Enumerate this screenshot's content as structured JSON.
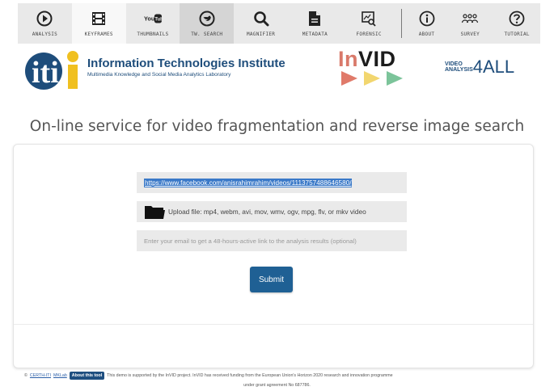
{
  "toolbar": {
    "items": [
      {
        "label": "ANALYSIS",
        "icon": "play-circle-icon"
      },
      {
        "label": "KEYFRAMES",
        "icon": "film-icon"
      },
      {
        "label": "THUMBNAILS",
        "icon": "youtube-icon"
      },
      {
        "label": "TW. SEARCH",
        "icon": "twitter-circle-icon"
      },
      {
        "label": "MAGNIFIER",
        "icon": "magnifier-icon"
      },
      {
        "label": "METADATA",
        "icon": "document-icon"
      },
      {
        "label": "FORENSIC",
        "icon": "forensic-icon"
      },
      {
        "label": "ABOUT",
        "icon": "info-icon"
      },
      {
        "label": "SURVEY",
        "icon": "survey-icon"
      },
      {
        "label": "TUTORIAL",
        "icon": "question-icon"
      }
    ],
    "active": "KEYFRAMES"
  },
  "header": {
    "iti_letters": "iti",
    "iti_title": "Information Technologies Institute",
    "iti_subtitle": "Multimedia Knowledge and Social Media Analytics Laboratory",
    "invid_in": "In",
    "invid_vid": "VID",
    "v4a_small_1": "VIDEO",
    "v4a_small_2": "ANALYSIS",
    "v4a_big": "4ALL",
    "colors": {
      "iti_blue": "#1e4d7b",
      "invid_in": "#d9796a",
      "triangle_1": "#e07a6a",
      "triangle_2": "#f2d66f",
      "triangle_3": "#7cc49a"
    }
  },
  "main": {
    "title": "On-line service for video fragmentation and reverse image search",
    "url_value": "https://www.facebook.com/anisrahimrahim/videos/1113757488646580/",
    "upload_label": "Upload file: mp4, webm, avi, mov, wmv, ogv, mpg, flv, or mkv video",
    "email_placeholder": "Enter your email to get a 48-hours-active link to the analysis results (optional)",
    "submit_label": "Submit",
    "submit_color": "#1f6094"
  },
  "footer": {
    "copyright": "©",
    "link1": "CERTH-ITI",
    "link2": "MKLab",
    "about_button": "About this tool",
    "notice_line1": "This demo is supported by the InVID project. InVID has received funding from the European Union's Horizon 2020 research and innovation programme",
    "notice_line2": "under grant agreement No 687786."
  }
}
